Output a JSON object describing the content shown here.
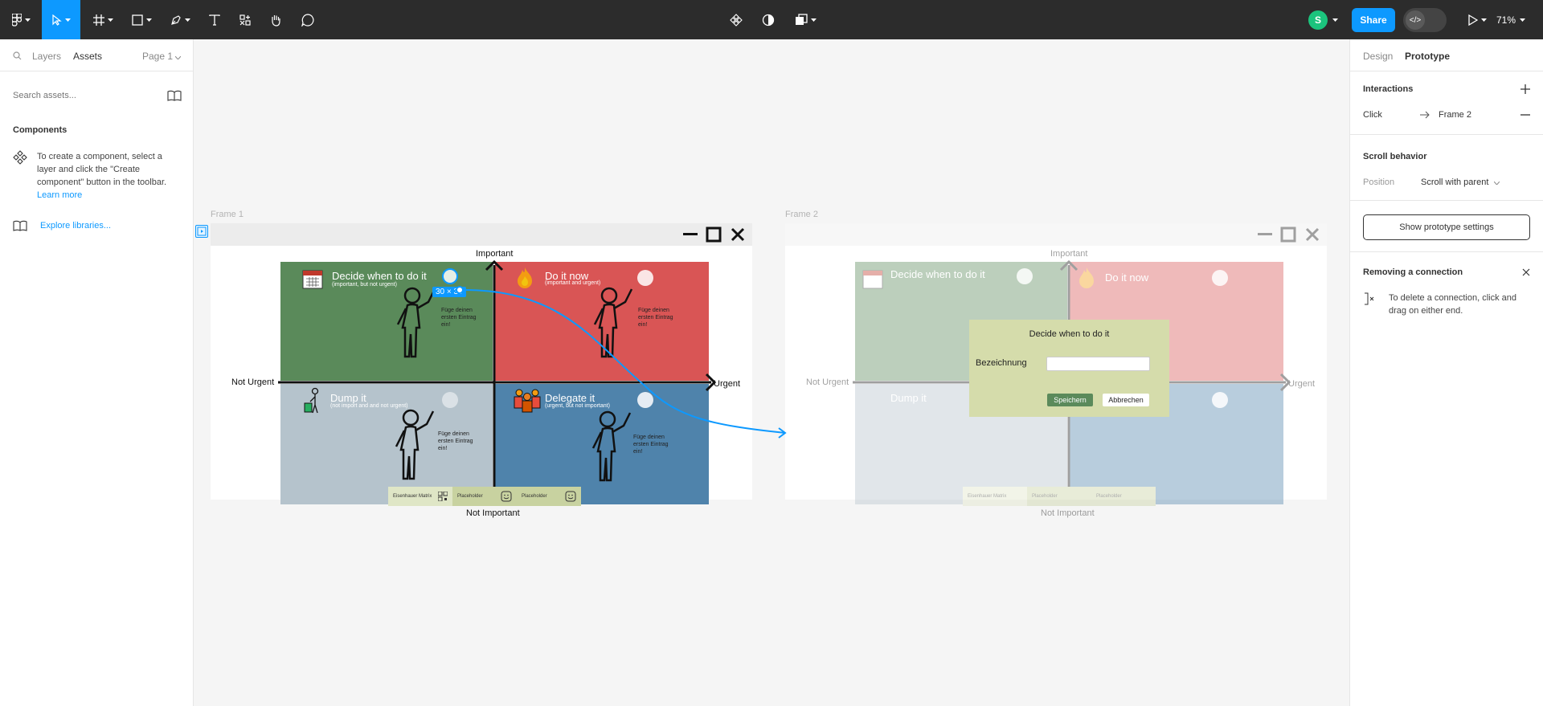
{
  "toolbar": {
    "share_label": "Share",
    "zoom": "71%",
    "user_initial": "S",
    "icons": [
      "figma-menu-icon",
      "move-icon",
      "frame-icon",
      "shape-icon",
      "pen-icon",
      "text-icon",
      "resources-icon",
      "hand-icon",
      "comment-icon",
      "component-icon",
      "contrast-icon",
      "boolean-icon",
      "play-icon"
    ]
  },
  "left_panel": {
    "tabs": [
      "Layers",
      "Assets"
    ],
    "page": "Page 1",
    "search_placeholder": "Search assets...",
    "components_title": "Components",
    "components_hint": "To create a component, select a layer and click the \"Create component\" button in the toolbar.",
    "learn_more": "Learn more",
    "explore": "Explore libraries..."
  },
  "right_panel": {
    "tabs": [
      "Design",
      "Prototype"
    ],
    "interactions_title": "Interactions",
    "interaction_trigger": "Click",
    "interaction_target": "Frame 2",
    "scroll_title": "Scroll behavior",
    "position_label": "Position",
    "position_value": "Scroll with parent",
    "settings_button": "Show prototype settings",
    "removing_title": "Removing a connection",
    "removing_hint": "To delete a connection, click and drag on either end."
  },
  "canvas": {
    "frame1": {
      "label": "Frame 1",
      "axis": {
        "top": "Important",
        "bottom": "Not Important",
        "left": "Not Urgent",
        "right": "Urgent"
      },
      "quadrants": [
        {
          "title": "Decide when to do it",
          "sub": "(important, but not urgent)",
          "color": "#5a8a5a",
          "hint": "Füge deinen ersten Eintrag ein!"
        },
        {
          "title": "Do it now",
          "sub": "(important and urgent)",
          "color": "#d95555",
          "hint": "Füge deinen ersten Eintrag ein!"
        },
        {
          "title": "Dump it",
          "sub": "(not import and and not urgent)",
          "color": "#b5c3cc",
          "hint": "Füge deinen ersten Eintrag ein!"
        },
        {
          "title": "Delegate it",
          "sub": "(urgent, but not important)",
          "color": "#4f83ab",
          "hint": "Füge deinen ersten Eintrag ein!"
        }
      ],
      "bottom_tabs": [
        "Eisenhauer Matrix",
        "Placeholder",
        "Placeholder"
      ],
      "selection_size": "30 × 30"
    },
    "frame2": {
      "label": "Frame 2",
      "dialog": {
        "title": "Decide when to do it",
        "field_label": "Bezeichnung",
        "save": "Speichern",
        "cancel": "Abbrechen"
      }
    }
  }
}
